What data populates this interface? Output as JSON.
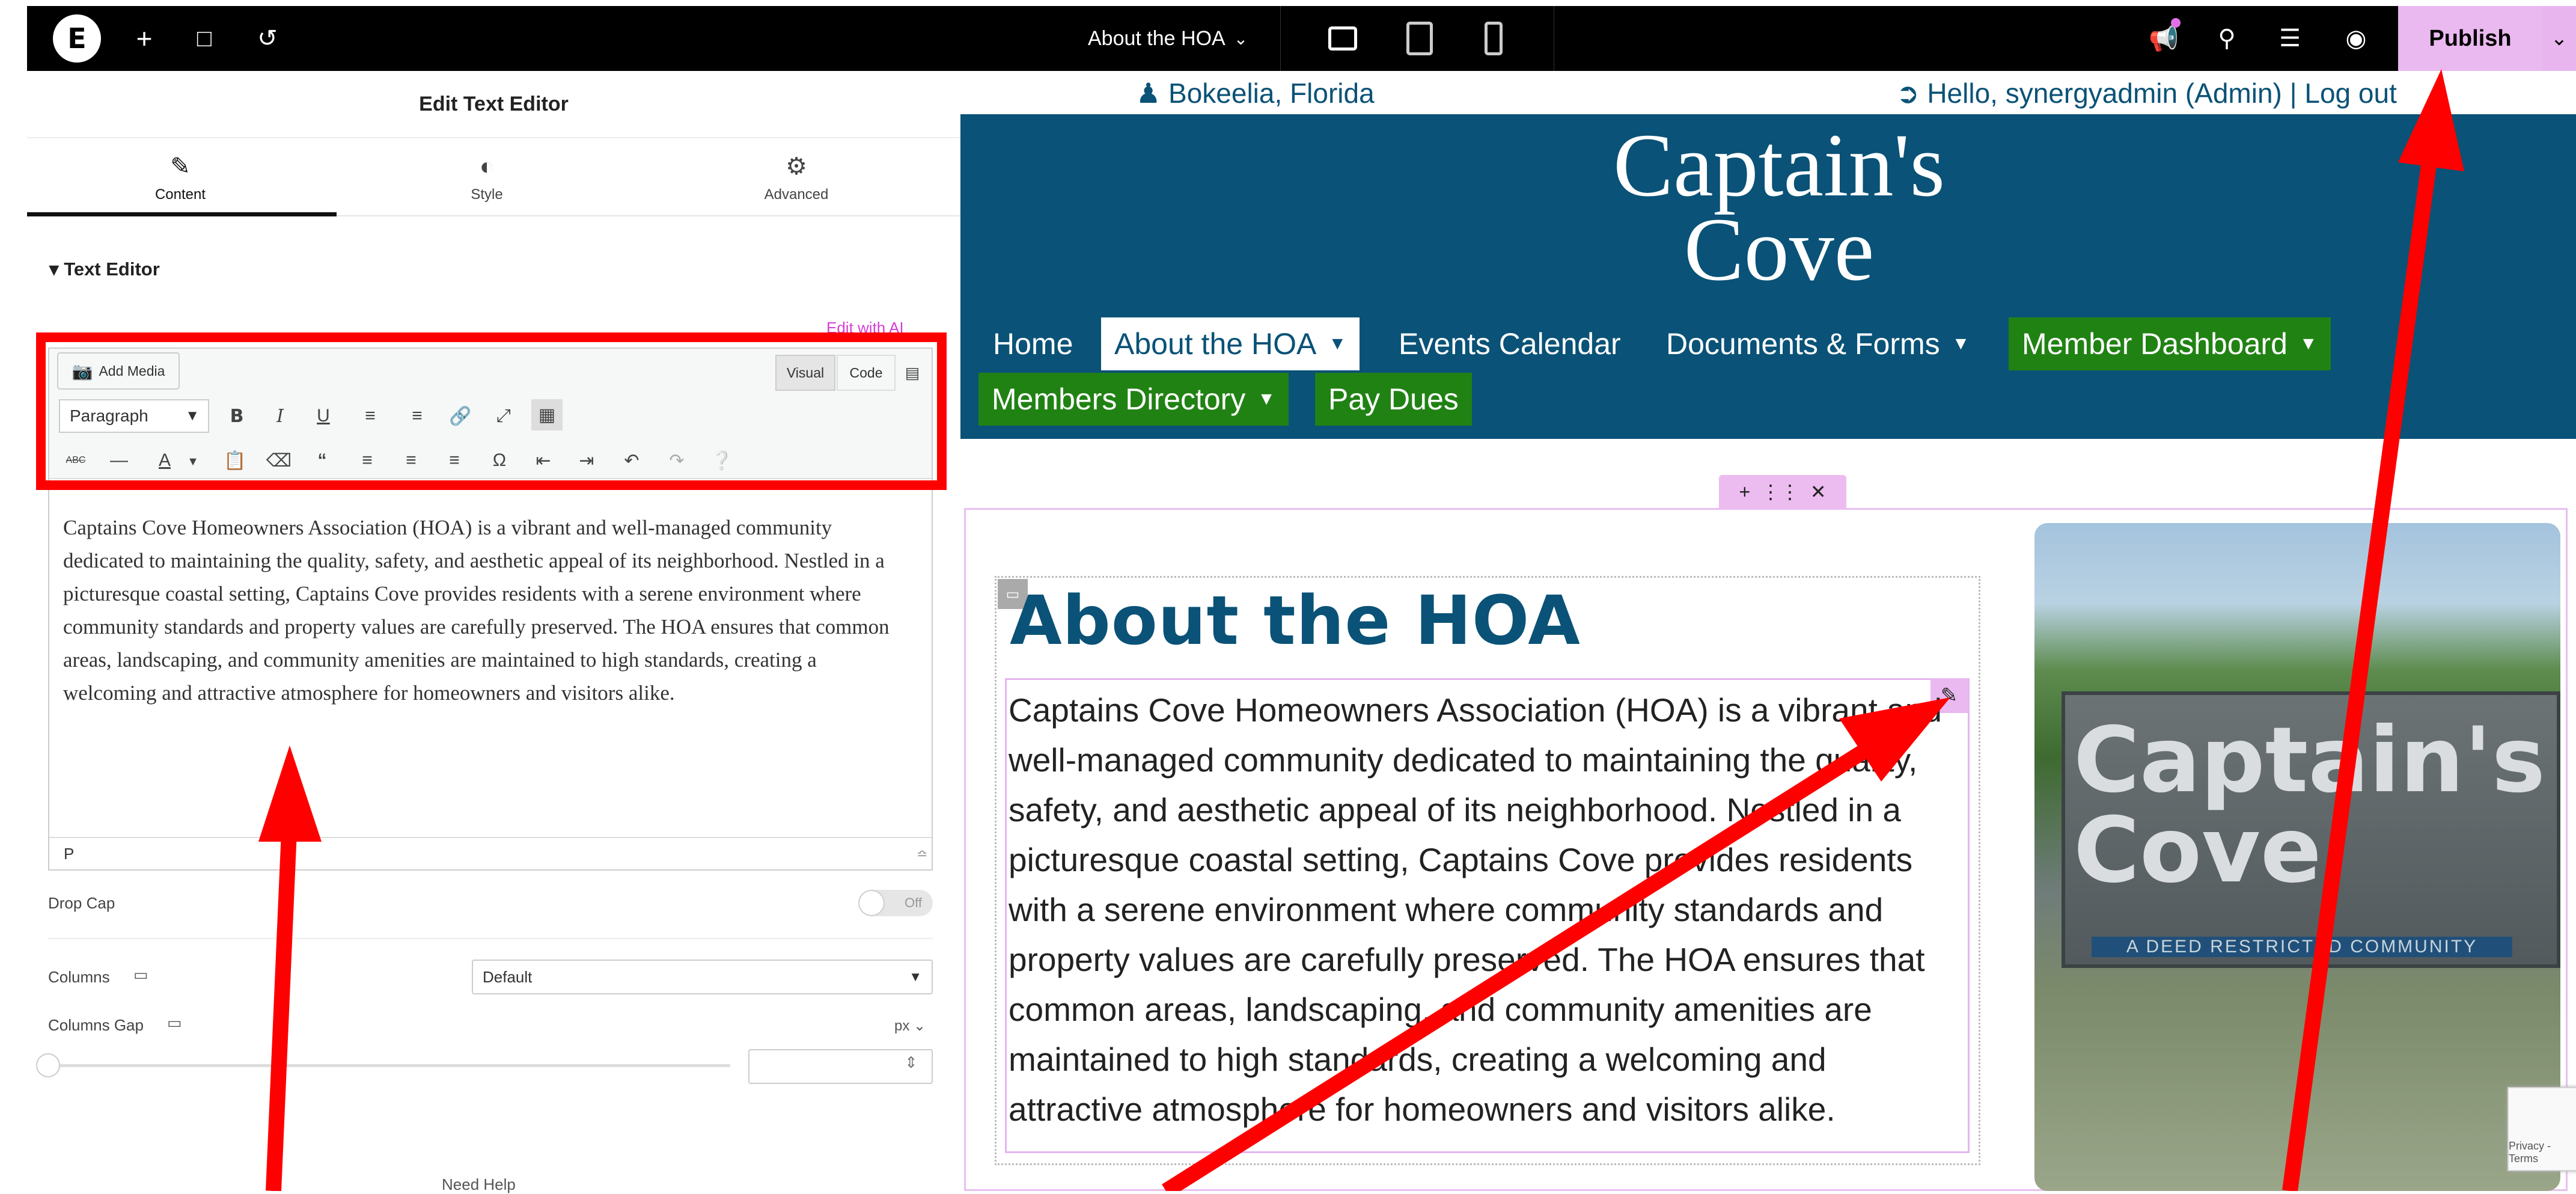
{
  "topbar": {
    "page_name": "About the HOA",
    "publish_label": "Publish",
    "icons": [
      "elementor-logo-icon",
      "add-icon",
      "page-settings-icon",
      "history-icon",
      "desktop-icon",
      "tablet-icon",
      "mobile-icon",
      "notifications-icon",
      "search-icon",
      "layers-icon",
      "preview-eye-icon"
    ]
  },
  "panel": {
    "title": "Edit Text Editor",
    "tabs": [
      {
        "label": "Content",
        "icon": "pencil-icon"
      },
      {
        "label": "Style",
        "icon": "contrast-icon"
      },
      {
        "label": "Advanced",
        "icon": "gear-icon"
      }
    ],
    "section_title": "Text Editor",
    "edit_with_ai": "Edit with AI",
    "add_media": "Add Media",
    "visual_tab": "Visual",
    "code_tab": "Code",
    "format": "Paragraph",
    "editor_text": "Captains Cove Homeowners Association (HOA) is a vibrant and well-managed community dedicated to maintaining the quality, safety, and aesthetic appeal of its neighborhood. Nestled in a picturesque coastal setting, Captains Cove provides residents with a serene environment where community standards and property values are carefully preserved. The HOA ensures that common areas, landscaping, and community amenities are maintained to high standards, creating a welcoming and attractive atmosphere for homeowners and visitors alike.",
    "status_path": "P",
    "drop_cap_label": "Drop Cap",
    "drop_cap_value": "Off",
    "columns_label": "Columns",
    "columns_value": "Default",
    "columns_gap_label": "Columns Gap",
    "columns_gap_unit": "px",
    "need_help": "Need Help"
  },
  "preview": {
    "location": "Bokeelia, Florida",
    "hello": "Hello, synergyadmin (Admin) | Log out",
    "logo_line1": "Captain's",
    "logo_line2": "Cove",
    "nav": [
      "Home",
      "About the HOA",
      "Events Calendar",
      "Documents & Forms",
      "Member Dashboard",
      "Members Directory",
      "Pay Dues"
    ],
    "heading": "About the HOA",
    "body": "Captains Cove Homeowners Association (HOA) is a vibrant and well-managed community dedicated to maintaining the quality, safety, and aesthetic appeal of its neighborhood. Nestled in a picturesque coastal setting, Captains Cove provides residents with a serene environment where community standards and property values are carefully preserved. The HOA ensures that common areas, landscaping, and community amenities are maintained to high standards, creating a welcoming and attractive atmosphere for homeowners and visitors alike.",
    "sign_text": "Captain's Cove",
    "sign_sub": "A DEED RESTRICTED COMMUNITY",
    "recaptcha": "Privacy - Terms"
  },
  "colors": {
    "brand_blue": "#0a5277",
    "nav_green": "#218214",
    "publish_pink": "#eab9f0",
    "annotation_red": "#ff0000"
  }
}
